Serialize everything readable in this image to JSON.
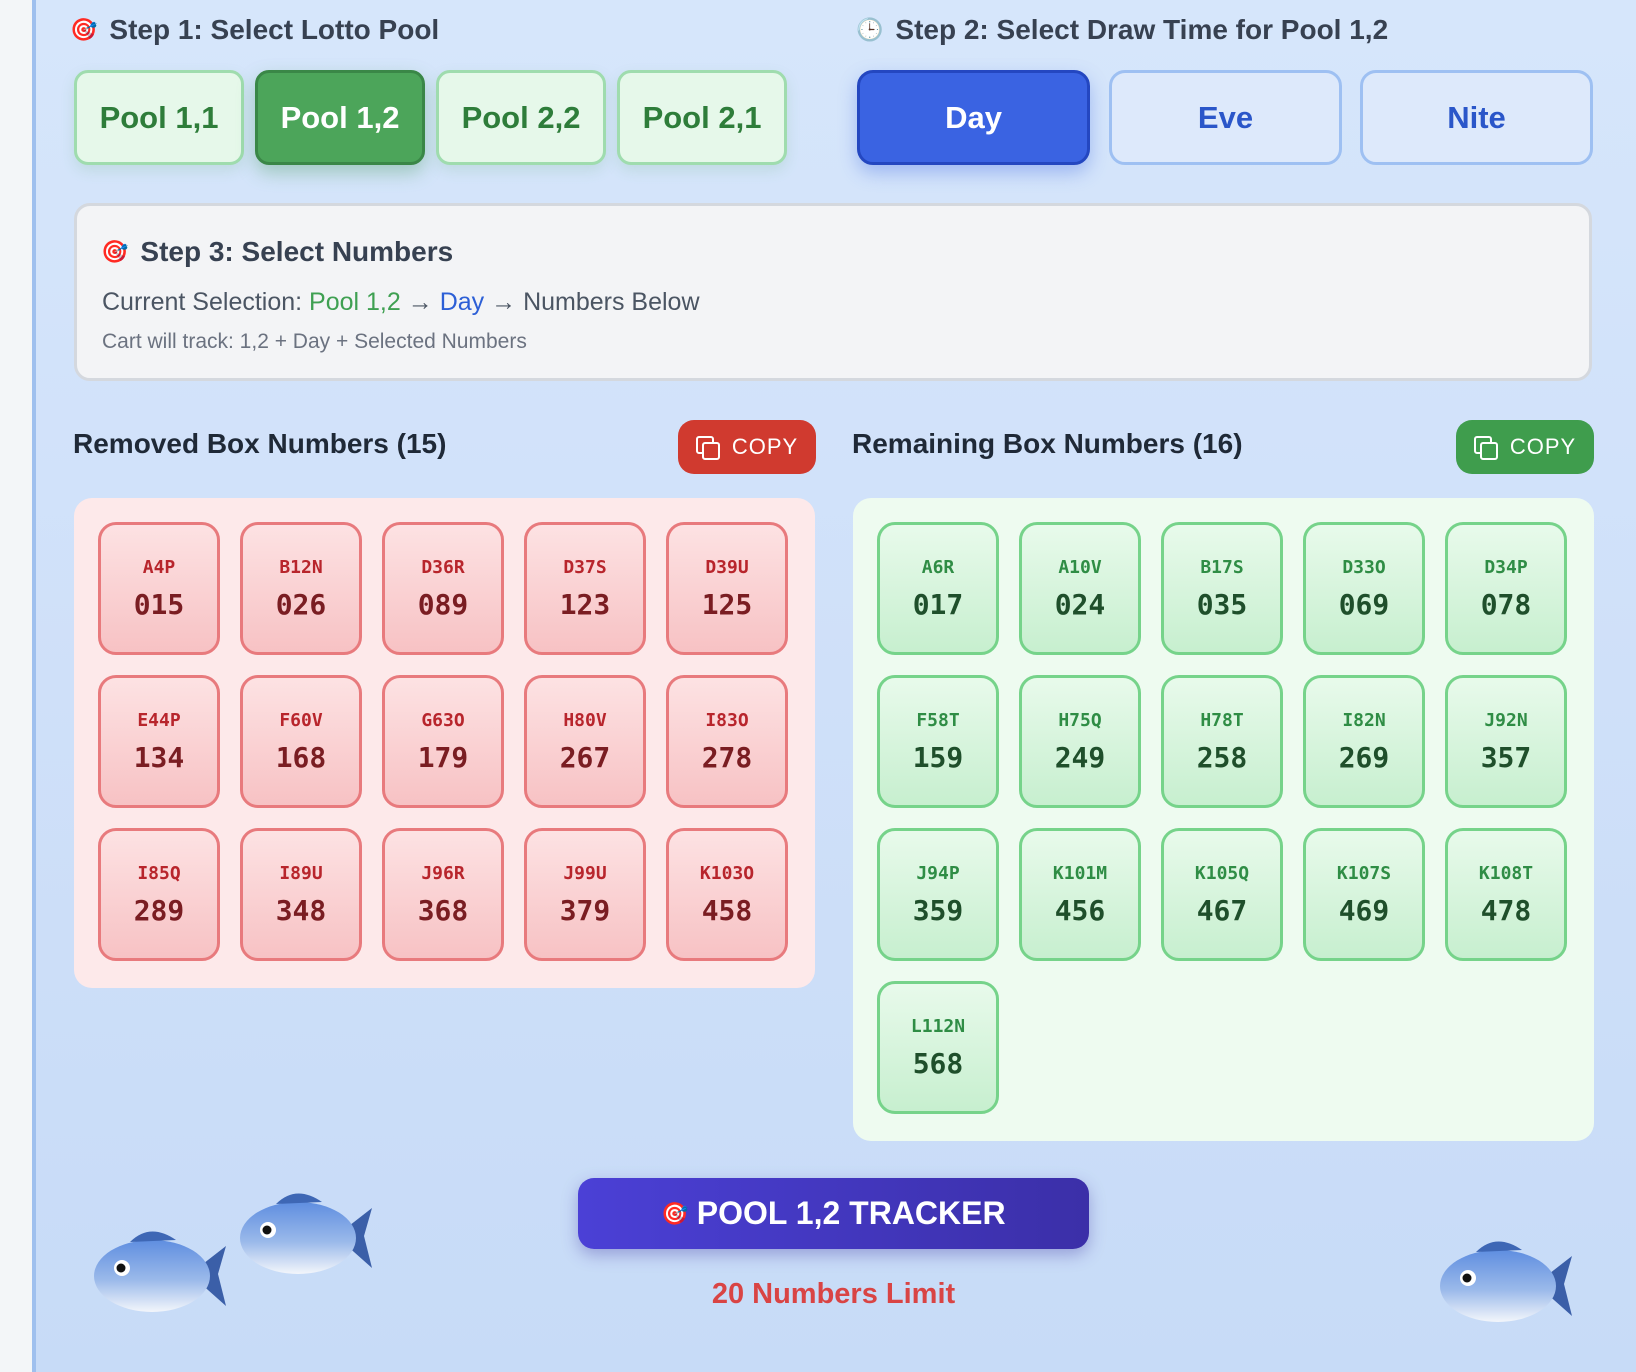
{
  "step1": {
    "icon": "target-icon",
    "title": "Step 1: Select Lotto Pool"
  },
  "pools": [
    {
      "label": "Pool 1,1",
      "active": false
    },
    {
      "label": "Pool 1,2",
      "active": true
    },
    {
      "label": "Pool 2,2",
      "active": false
    },
    {
      "label": "Pool 2,1",
      "active": false
    }
  ],
  "step2": {
    "icon": "clock-icon",
    "title": "Step 2: Select Draw Time for Pool 1,2"
  },
  "times": [
    {
      "label": "Day",
      "active": true
    },
    {
      "label": "Eve",
      "active": false
    },
    {
      "label": "Nite",
      "active": false
    }
  ],
  "step3": {
    "icon": "target-icon",
    "title": "Step 3: Select Numbers",
    "current_prefix": "Current Selection: ",
    "current_pool": "Pool 1,2",
    "arrow1": " → ",
    "current_time": "Day",
    "arrow2": " → Numbers Below",
    "cart_track": "Cart will track: 1,2 + Day + Selected Numbers"
  },
  "removed": {
    "title": "Removed Box Numbers (15)",
    "copy_label": "COPY",
    "items": [
      {
        "code": "A4P",
        "num": "015"
      },
      {
        "code": "B12N",
        "num": "026"
      },
      {
        "code": "D36R",
        "num": "089"
      },
      {
        "code": "D37S",
        "num": "123"
      },
      {
        "code": "D39U",
        "num": "125"
      },
      {
        "code": "E44P",
        "num": "134"
      },
      {
        "code": "F60V",
        "num": "168"
      },
      {
        "code": "G63O",
        "num": "179"
      },
      {
        "code": "H80V",
        "num": "267"
      },
      {
        "code": "I83O",
        "num": "278"
      },
      {
        "code": "I85Q",
        "num": "289"
      },
      {
        "code": "I89U",
        "num": "348"
      },
      {
        "code": "J96R",
        "num": "368"
      },
      {
        "code": "J99U",
        "num": "379"
      },
      {
        "code": "K103O",
        "num": "458"
      }
    ]
  },
  "remaining": {
    "title": "Remaining Box Numbers (16)",
    "copy_label": "COPY",
    "items": [
      {
        "code": "A6R",
        "num": "017"
      },
      {
        "code": "A10V",
        "num": "024"
      },
      {
        "code": "B17S",
        "num": "035"
      },
      {
        "code": "D33O",
        "num": "069"
      },
      {
        "code": "D34P",
        "num": "078"
      },
      {
        "code": "F58T",
        "num": "159"
      },
      {
        "code": "H75Q",
        "num": "249"
      },
      {
        "code": "H78T",
        "num": "258"
      },
      {
        "code": "I82N",
        "num": "269"
      },
      {
        "code": "J92N",
        "num": "357"
      },
      {
        "code": "J94P",
        "num": "359"
      },
      {
        "code": "K101M",
        "num": "456"
      },
      {
        "code": "K105Q",
        "num": "467"
      },
      {
        "code": "K107S",
        "num": "469"
      },
      {
        "code": "K108T",
        "num": "478"
      },
      {
        "code": "L112N",
        "num": "568"
      }
    ]
  },
  "tracker": {
    "icon": "target-icon",
    "label": "POOL 1,2 TRACKER",
    "limit": "20 Numbers Limit"
  },
  "decor": {
    "fish_icon": "fish-icon"
  }
}
